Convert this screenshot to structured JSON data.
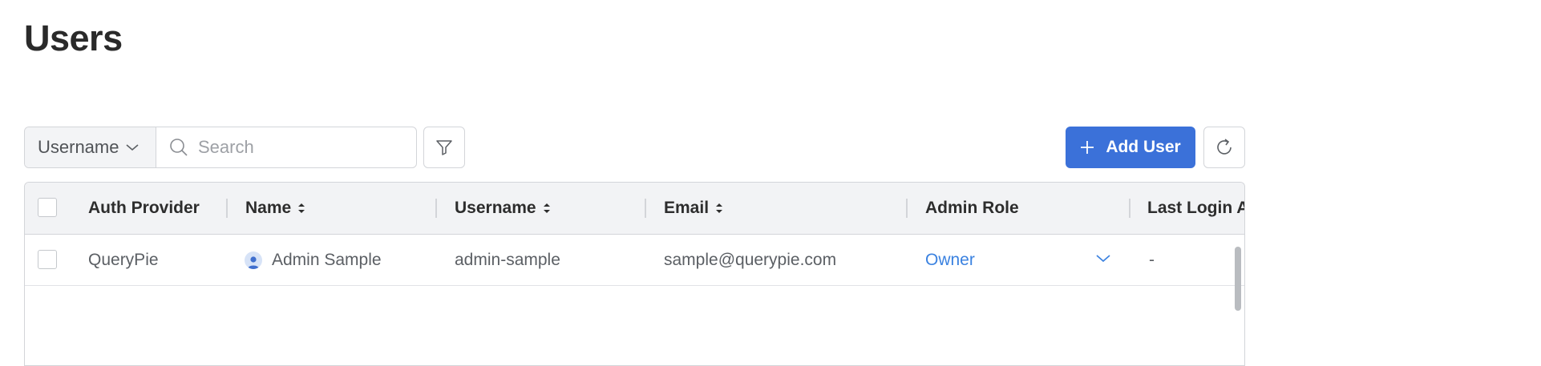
{
  "page": {
    "title": "Users"
  },
  "toolbar": {
    "field_select": {
      "value": "Username"
    },
    "search": {
      "placeholder": "Search",
      "value": ""
    },
    "add_user_label": "Add User"
  },
  "table": {
    "columns": [
      "Auth Provider",
      "Name",
      "Username",
      "Email",
      "Admin Role",
      "Last Login A"
    ],
    "sortable": [
      "Name",
      "Username",
      "Email"
    ],
    "rows": [
      {
        "auth_provider": "QueryPie",
        "name": "Admin Sample",
        "username": "admin-sample",
        "email": "sample@querypie.com",
        "admin_role": "Owner",
        "last_login": "-"
      }
    ]
  },
  "colors": {
    "accent": "#3b71d9",
    "link": "#3b82e0"
  }
}
